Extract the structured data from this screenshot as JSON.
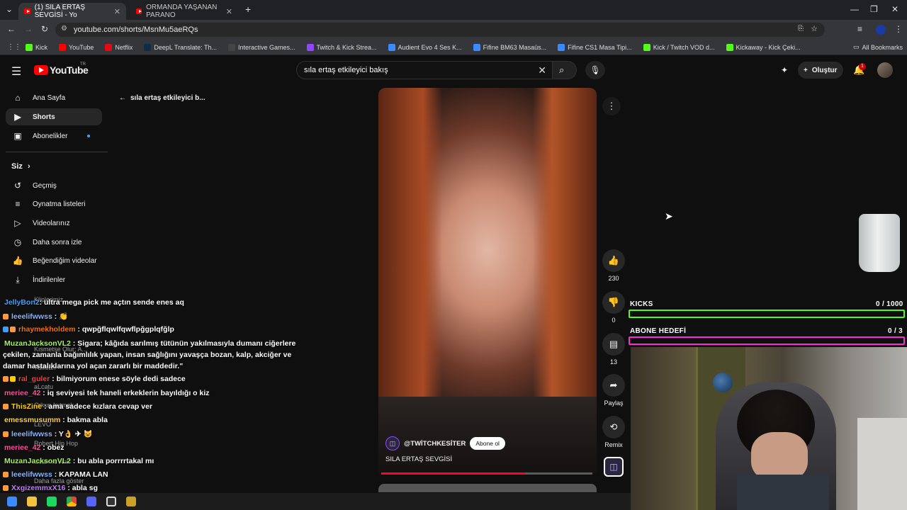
{
  "browser": {
    "tabs": [
      {
        "title": "(1) SILA ERTAŞ SEVGİSİ - Yo",
        "active": true
      },
      {
        "title": "ORMANDA YAŞANAN PARANO",
        "active": false
      }
    ],
    "new_tab": "+",
    "url": "youtube.com/shorts/MsnMu5aeRQs",
    "bookmarks": [
      "Kick",
      "YouTube",
      "Netflix",
      "DeepL Translate: Th...",
      "Interactive Games...",
      "Twitch & Kick Strea...",
      "Audient Evo 4 Ses K...",
      "Fifine BM63 Masaüs...",
      "Fifine CS1 Masa Tipi...",
      "Kick / Twitch VOD d...",
      "Kickaway - Kick Çeki..."
    ],
    "all_bookmarks": "All Bookmarks"
  },
  "youtube": {
    "logo": "YouTube",
    "logo_sup": "TR",
    "search_value": "sıla ertaş etkileyici bakış",
    "create_label": "Oluştur",
    "notif_count": "1",
    "back_query": "sıla ertaş etkileyici b..."
  },
  "sidebar": {
    "items": [
      {
        "label": "Ana Sayfa",
        "icon": "home-icon",
        "glyph": "⌂"
      },
      {
        "label": "Shorts",
        "icon": "shorts-icon",
        "glyph": "▶"
      },
      {
        "label": "Abonelikler",
        "icon": "subscriptions-icon",
        "glyph": "▣"
      }
    ],
    "you_label": "Siz",
    "you_items": [
      {
        "label": "Geçmiş",
        "icon": "history-icon",
        "glyph": "↺"
      },
      {
        "label": "Oynatma listeleri",
        "icon": "playlist-icon",
        "glyph": "≡"
      },
      {
        "label": "Videolarınız",
        "icon": "your-videos-icon",
        "glyph": "▷"
      },
      {
        "label": "Daha sonra izle",
        "icon": "watch-later-icon",
        "glyph": "◷"
      },
      {
        "label": "Beğendiğim videolar",
        "icon": "liked-icon",
        "glyph": "👍"
      },
      {
        "label": "İndirilenler",
        "icon": "download-icon",
        "glyph": "⤓"
      }
    ],
    "partial": [
      "Kliplerimiz",
      "Kısmetse Olur: A...",
      "Tullisan",
      "aLcatu",
      "Orkun Işıtmak",
      "LEVO",
      "Robert Hip Hop",
      "Uzun ve Ani",
      "Daha fazla göster"
    ]
  },
  "chat": [
    {
      "user": "JellyBon2",
      "color": "#3fa0ff",
      "msg": ": ultra mega pick me açtın sende enes aq"
    },
    {
      "user": "leeelifwwss",
      "color": "#8ab4ff",
      "msg": " : 👏"
    },
    {
      "user": "rhaymekholdem",
      "color": "#ff6a00",
      "msg": " : qwpğflqwlfqwflpğgplqfğlp"
    },
    {
      "user": "MuzanJacksonVL2",
      "color": "#9cff3a",
      "msg": " : Sigara; kâğıda sarılmış tütünün yakılmasıyla dumanı ciğerlere"
    },
    {
      "user": "",
      "color": "#fff",
      "msg": "çekilen, zamanla bağımlılık yapan, insan sağlığını yavaşça bozan, kalp, akciğer ve"
    },
    {
      "user": "",
      "color": "#fff",
      "msg": "damar hastalıklarına yol açan zararlı bir maddedir.\""
    },
    {
      "user": "ral_guler",
      "color": "#ff3a3a",
      "msg": " : bilmiyorum enese söyle dedi sadece"
    },
    {
      "user": "meriee_42",
      "color": "#ff4fa0",
      "msg": " : iq seviyesi tek haneli erkeklerin bayıldığı o kiz"
    },
    {
      "user": "ThisZine",
      "color": "#ffcc00",
      "msg": " : ama sadece kızlara cevap ver"
    },
    {
      "user": "emessmusumm",
      "color": "#ffd23a",
      "msg": " : bakma abla"
    },
    {
      "user": "leeelifwwss",
      "color": "#8ab4ff",
      "msg": " : Y👌 ✈ 😺"
    },
    {
      "user": "meriee_42",
      "color": "#ff4fa0",
      "msg": " : obez"
    },
    {
      "user": "MuzanJacksonVL2",
      "color": "#9cff3a",
      "msg": " : bu abla porrrrtakal mı"
    },
    {
      "user": "leeelifwwss",
      "color": "#8ab4ff",
      "msg": " : KAPAMA LAN"
    },
    {
      "user": "XxgizemmxX16",
      "color": "#c07aff",
      "msg": " : abla sg"
    }
  ],
  "video": {
    "channel": "@TWİTCHKESİTER",
    "subscribe": "Abone ol",
    "title": "SILA ERTAŞ SEVGİSİ",
    "progress": 0.68
  },
  "actions": [
    {
      "icon": "like-icon",
      "glyph": "👍",
      "label": "230"
    },
    {
      "icon": "dislike-icon",
      "glyph": "👎",
      "label": "0"
    },
    {
      "icon": "comments-icon",
      "glyph": "▤",
      "label": "13"
    },
    {
      "icon": "share-icon",
      "glyph": "➦",
      "label": "Paylaş"
    },
    {
      "icon": "remix-icon",
      "glyph": "⟲",
      "label": "Remix"
    }
  ],
  "overlay": {
    "kicks_label": "KICKS",
    "kicks_value": "0 / 1000",
    "kicks_color": "#53fc18",
    "sub_label": "ABONE HEDEFİ",
    "sub_value": "0 / 3",
    "sub_color": "#ff2bd6"
  }
}
